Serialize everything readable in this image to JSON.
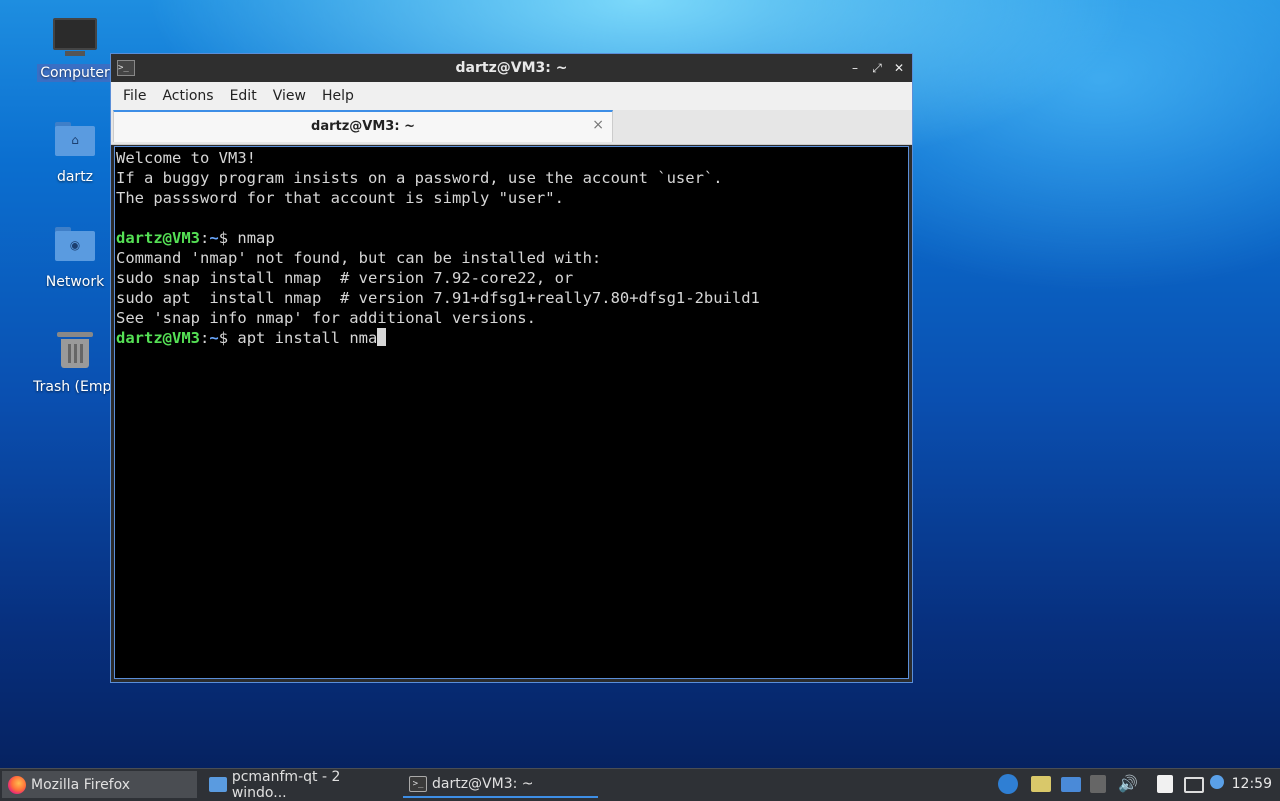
{
  "desktop": {
    "icons": [
      {
        "label": "Computer"
      },
      {
        "label": "dartz"
      },
      {
        "label": "Network"
      },
      {
        "label": "Trash (Empt"
      }
    ]
  },
  "window": {
    "title": "dartz@VM3: ~",
    "controls": {
      "minimize": "–",
      "maximize": "⤢",
      "close": "✕"
    },
    "menu": [
      "File",
      "Actions",
      "Edit",
      "View",
      "Help"
    ],
    "tab": {
      "label": "dartz@VM3: ~",
      "close": "×"
    }
  },
  "terminal": {
    "prompt_user": "dartz@VM3",
    "prompt_sep": ":",
    "prompt_path": "~",
    "prompt_end": "$ ",
    "lines": [
      "Welcome to VM3!",
      "If a buggy program insists on a password, use the account `user`.",
      "The passsword for that account is simply \"user\".",
      ""
    ],
    "cmd1": "nmap",
    "output": [
      "Command 'nmap' not found, but can be installed with:",
      "sudo snap install nmap  # version 7.92-core22, or",
      "sudo apt  install nmap  # version 7.91+dfsg1+really7.80+dfsg1-2build1",
      "See 'snap info nmap' for additional versions."
    ],
    "cmd2": "apt install nma"
  },
  "taskbar": {
    "tasks": [
      {
        "label": "Mozilla Firefox",
        "icon": "firefox-icon"
      },
      {
        "label": "pcmanfm-qt - 2 windo...",
        "icon": "folder-icon"
      },
      {
        "label": "dartz@VM3: ~",
        "icon": "terminal-icon"
      }
    ],
    "clock": "12:59"
  },
  "colors": {
    "prompt_user": "#55e055",
    "prompt_path": "#6aa8ff",
    "accent": "#3d8ee6"
  }
}
